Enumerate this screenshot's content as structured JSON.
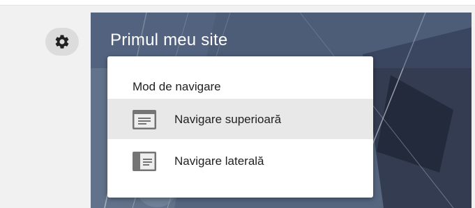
{
  "site": {
    "title": "Primul meu site"
  },
  "toolbar": {
    "settings_icon": "gear-icon"
  },
  "navigation_menu": {
    "heading": "Mod de navigare",
    "items": [
      {
        "label": "Navigare superioară",
        "icon": "top-navigation-icon",
        "selected": true
      },
      {
        "label": "Navigare laterală",
        "icon": "side-navigation-icon",
        "selected": false
      }
    ]
  },
  "colors": {
    "menu_selected_bg": "#e8e8e8",
    "preview_bg": "#596a86",
    "icon_gray": "#757575"
  }
}
